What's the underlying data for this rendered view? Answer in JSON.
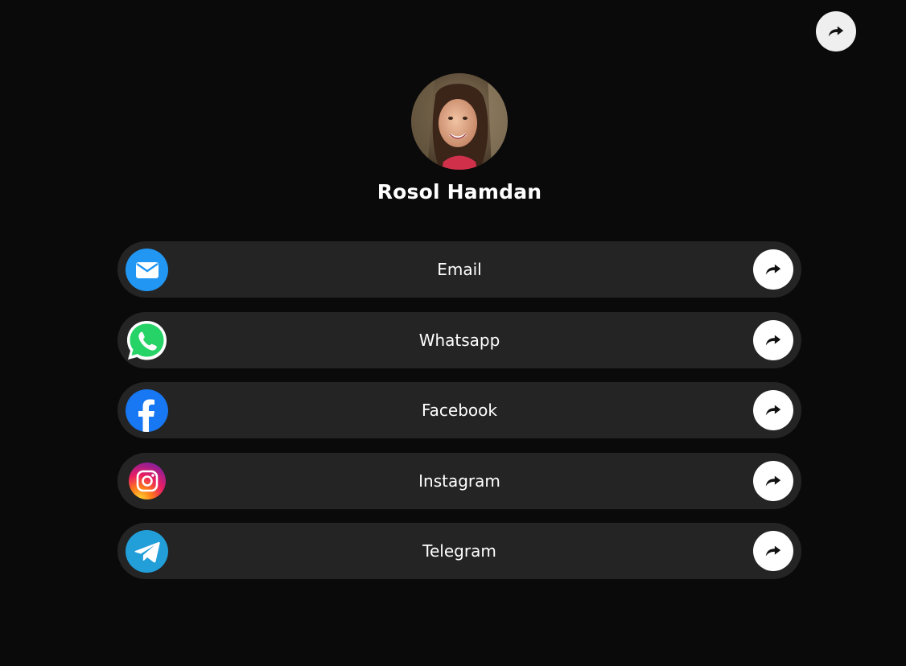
{
  "profile": {
    "name": "Rosol Hamdan"
  },
  "links": [
    {
      "label": "Email",
      "icon": "email-icon"
    },
    {
      "label": "Whatsapp",
      "icon": "whatsapp-icon"
    },
    {
      "label": "Facebook",
      "icon": "facebook-icon"
    },
    {
      "label": "Instagram",
      "icon": "instagram-icon"
    },
    {
      "label": "Telegram",
      "icon": "telegram-icon"
    }
  ],
  "colors": {
    "background": "#0a0a0a",
    "card": "#242424",
    "email": "#2196f3",
    "whatsapp": "#25d366",
    "facebook": "#1877f2",
    "telegram": "#229ed9"
  }
}
